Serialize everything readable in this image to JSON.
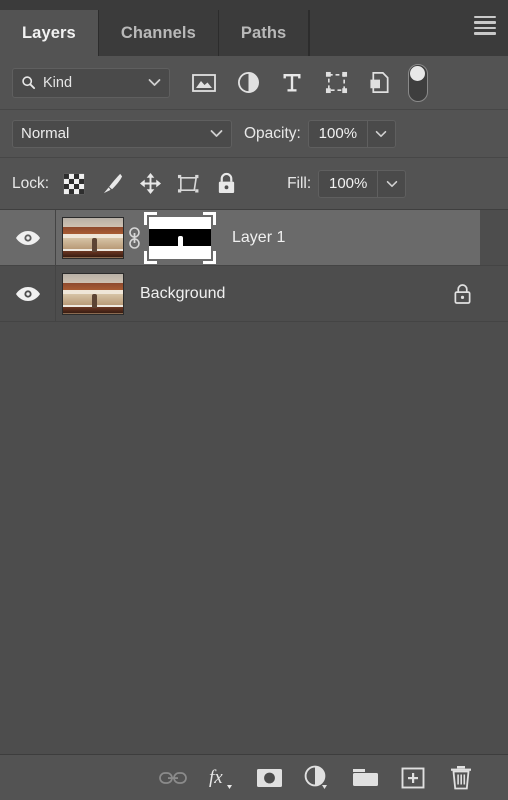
{
  "panel": {
    "title": "Layers",
    "menu_icon": "hamburger-menu-icon",
    "background_color": "#535353",
    "selected_row_color": "#6a6a6a",
    "list_background_color": "#4d4d4d"
  },
  "tabs": [
    {
      "label": "Layers",
      "active": true
    },
    {
      "label": "Channels",
      "active": false
    },
    {
      "label": "Paths",
      "active": false
    }
  ],
  "filter": {
    "kind_label": "Kind",
    "search_icon": "magnifier-icon",
    "chevron_icon": "chevron-down-icon",
    "type_filters": [
      {
        "name": "filter-pixel-layers",
        "icon": "image-icon"
      },
      {
        "name": "filter-adjustment-layers",
        "icon": "half-circle-icon"
      },
      {
        "name": "filter-type-layers",
        "icon": "text-t-icon"
      },
      {
        "name": "filter-shape-layers",
        "icon": "shape-icon"
      },
      {
        "name": "filter-smart-objects",
        "icon": "smart-object-icon"
      },
      {
        "name": "filter-toggle-switch",
        "icon": "toggle-switch-icon"
      }
    ],
    "toggle_on": true
  },
  "blend": {
    "mode": "Normal",
    "mode_chevron": "chevron-down-icon",
    "opacity_label": "Opacity:",
    "opacity_value": "100%",
    "opacity_chevron": "chevron-down-icon"
  },
  "lock": {
    "label": "Lock:",
    "buttons": [
      {
        "name": "lock-transparent-pixels",
        "icon": "checkerboard-icon"
      },
      {
        "name": "lock-image-pixels",
        "icon": "brush-icon"
      },
      {
        "name": "lock-position",
        "icon": "move-arrows-icon"
      },
      {
        "name": "lock-artboard-nesting",
        "icon": "artboard-icon"
      },
      {
        "name": "lock-all",
        "icon": "lock-icon"
      }
    ],
    "fill_label": "Fill:",
    "fill_value": "100%",
    "fill_chevron": "chevron-down-icon"
  },
  "layers": [
    {
      "name": "Layer 1",
      "visible": true,
      "selected": true,
      "has_mask": true,
      "mask_selected": true,
      "linked": true,
      "locked": false,
      "eye_icon": "eye-icon",
      "link_icon": "chain-link-icon",
      "thumbnail": "beach-sunset-photo",
      "mask_thumbnail": "black-white-gradient-mask"
    },
    {
      "name": "Background",
      "visible": true,
      "selected": false,
      "has_mask": false,
      "linked": false,
      "locked": true,
      "eye_icon": "eye-icon",
      "lock_icon": "lock-outline-icon",
      "thumbnail": "beach-sunset-photo"
    }
  ],
  "bottom_bar": {
    "buttons": [
      {
        "name": "link-layers-button",
        "icon": "chain-link-icon",
        "label": "",
        "disabled": true
      },
      {
        "name": "layer-style-button",
        "icon": "fx-icon",
        "label": "fx",
        "disabled": false
      },
      {
        "name": "add-layer-mask-button",
        "icon": "mask-icon",
        "label": "",
        "disabled": false
      },
      {
        "name": "new-adjustment-layer-button",
        "icon": "half-circle-icon",
        "label": "",
        "disabled": false
      },
      {
        "name": "new-group-button",
        "icon": "folder-icon",
        "label": "",
        "disabled": false
      },
      {
        "name": "new-layer-button",
        "icon": "plus-square-icon",
        "label": "",
        "disabled": false
      },
      {
        "name": "delete-layer-button",
        "icon": "trash-icon",
        "label": "",
        "disabled": false
      }
    ]
  }
}
